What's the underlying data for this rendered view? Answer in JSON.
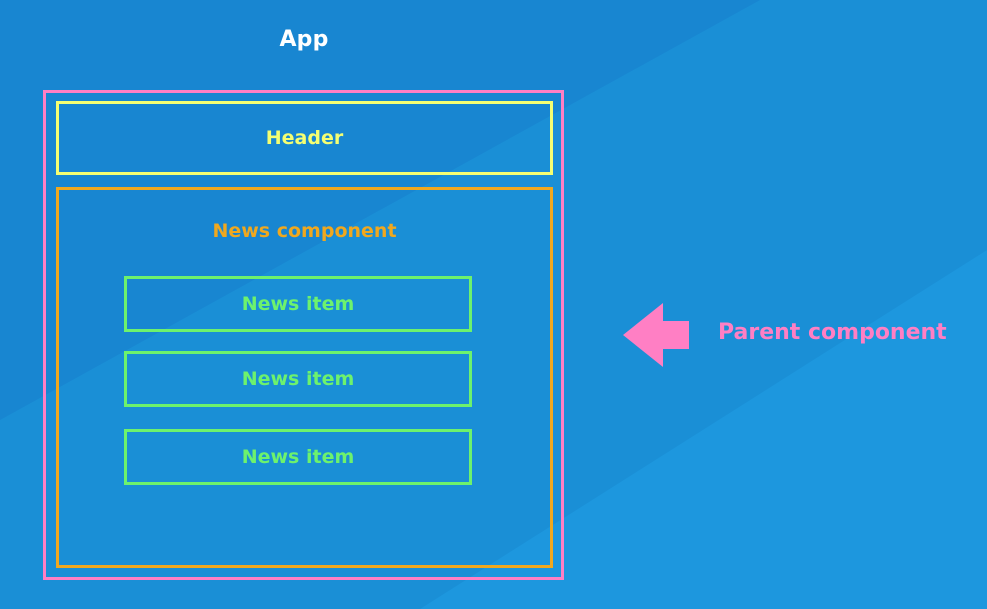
{
  "title": "App",
  "app_component": {
    "header_label": "Header",
    "news_component": {
      "label": "News component",
      "items": [
        "News item",
        "News item",
        "News item"
      ]
    }
  },
  "annotation": {
    "label": "Parent component",
    "icon": "arrow-left-icon"
  },
  "colors": {
    "background": "#1a8fd6",
    "app_border": "#ff7fc4",
    "header_border": "#f4ff72",
    "news_border": "#f0a81e",
    "news_item_border": "#6df26d",
    "annotation": "#ff7fc4"
  }
}
